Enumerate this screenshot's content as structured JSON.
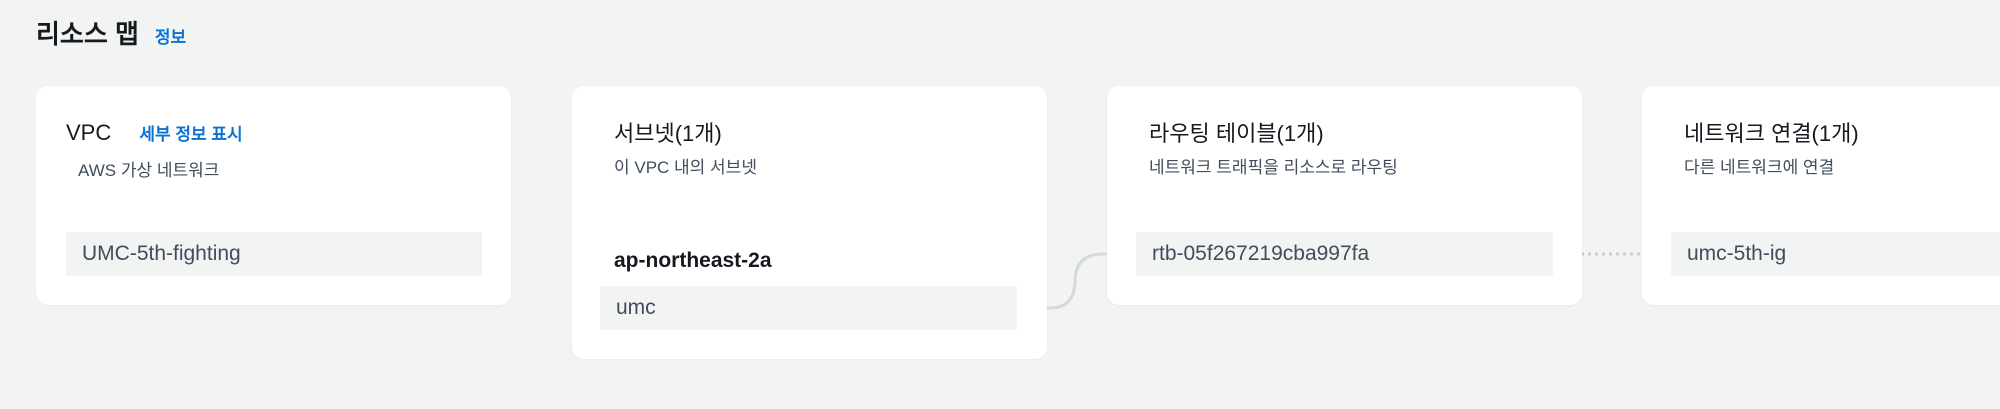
{
  "header": {
    "title": "리소스 맵",
    "info_label": "정보"
  },
  "vpc": {
    "heading": "VPC",
    "detail_label": "세부 정보 표시",
    "description": "AWS 가상 네트워크",
    "resource": "UMC-5th-fighting"
  },
  "subnets": {
    "heading": "서브넷(1개)",
    "description": "이 VPC 내의 서브넷",
    "az": "ap-northeast-2a",
    "resource": "umc"
  },
  "route_tables": {
    "heading": "라우팅 테이블(1개)",
    "description": "네트워크 트래픽을 리소스로 라우팅",
    "resource": "rtb-05f267219cba997fa"
  },
  "network_connections": {
    "heading": "네트워크 연결(1개)",
    "description": "다른 네트워크에 연결",
    "resource": "umc-5th-ig"
  },
  "colors": {
    "link": "#0972d3",
    "background": "#f2f3f3",
    "card": "#ffffff",
    "connector": "#d1d5db"
  }
}
